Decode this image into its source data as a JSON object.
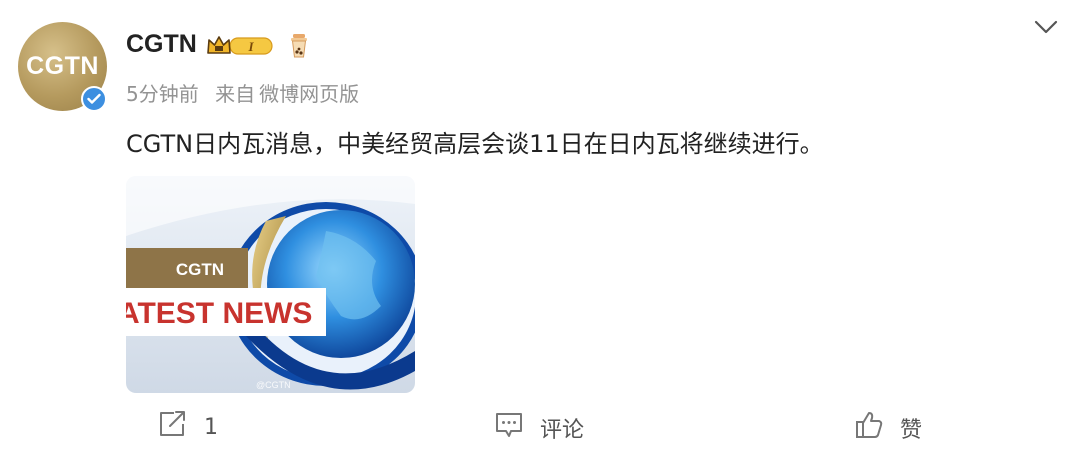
{
  "post": {
    "avatar_text": "CGTN",
    "username": "CGTN",
    "vip_level": "I",
    "time": "5分钟前",
    "source_prefix": "来自",
    "source": "微博网页版",
    "content": "CGTN日内瓦消息，中美经贸高层会谈11日在日内瓦将继续进行。",
    "image": {
      "banner_label": "CGTN",
      "headline": "ATEST NEWS",
      "watermark": "@CGTN"
    }
  },
  "actions": {
    "share_count": "1",
    "comment_label": "评论",
    "like_label": "赞"
  },
  "colors": {
    "gold": "#b59a5e",
    "verified_blue": "#3d8fe0",
    "headline_red": "#c8332e",
    "meta_gray": "#939393"
  },
  "icons": [
    "chevron-down-icon",
    "verified-icon",
    "crown-icon",
    "bubble-tea-icon",
    "share-icon",
    "comment-icon",
    "like-icon"
  ]
}
